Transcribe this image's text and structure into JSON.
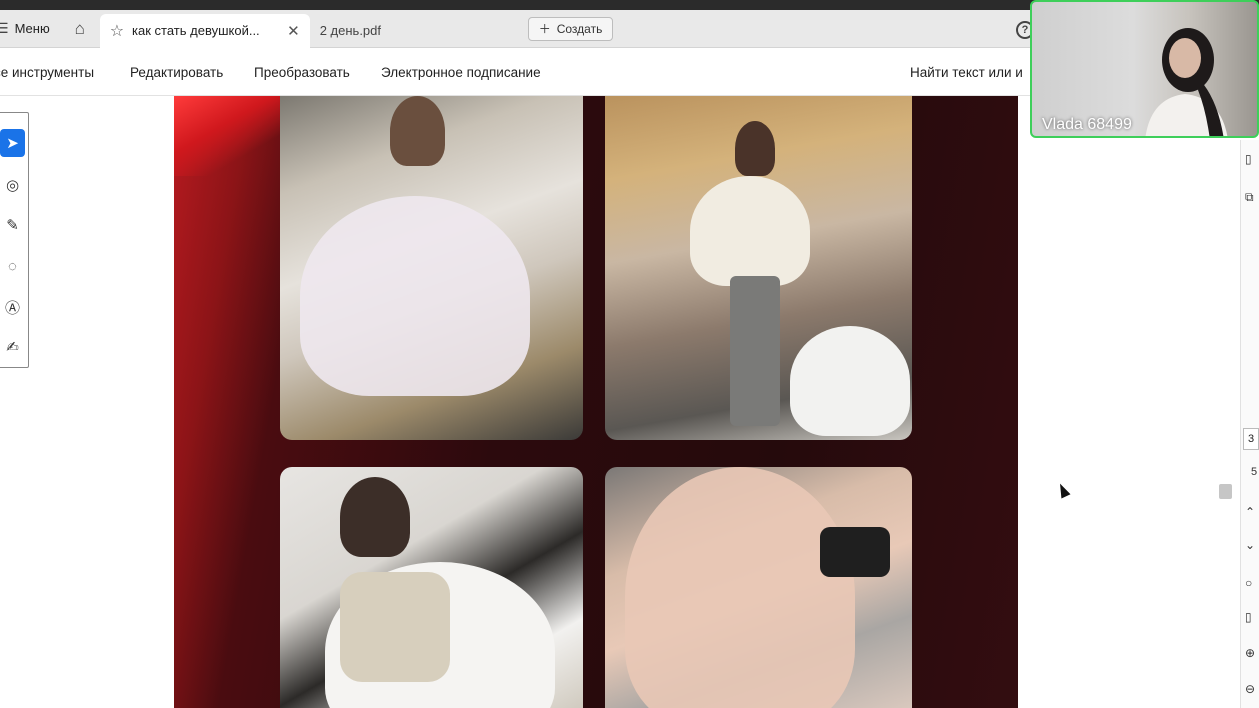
{
  "tabs_bar": {
    "menu_label": "Меню",
    "tabs": [
      {
        "label": "как стать девушкой...",
        "active": true
      },
      {
        "label": "2 день.pdf",
        "active": false
      }
    ],
    "create_label": "Создать"
  },
  "toolbar": {
    "items": [
      "се инструменты",
      "Редактировать",
      "Преобразовать",
      "Электронное подписание",
      "Найти текст или и"
    ]
  },
  "tools": [
    "select-tool",
    "comment-tool",
    "draw-tool",
    "lasso-tool",
    "text-tool",
    "stamp-tool"
  ],
  "page_nav": {
    "current": "3",
    "total": "5"
  },
  "video_call": {
    "participant_name": "Vlada 68499",
    "border_color": "#3ecf5a"
  },
  "accent": "#1a73e8"
}
